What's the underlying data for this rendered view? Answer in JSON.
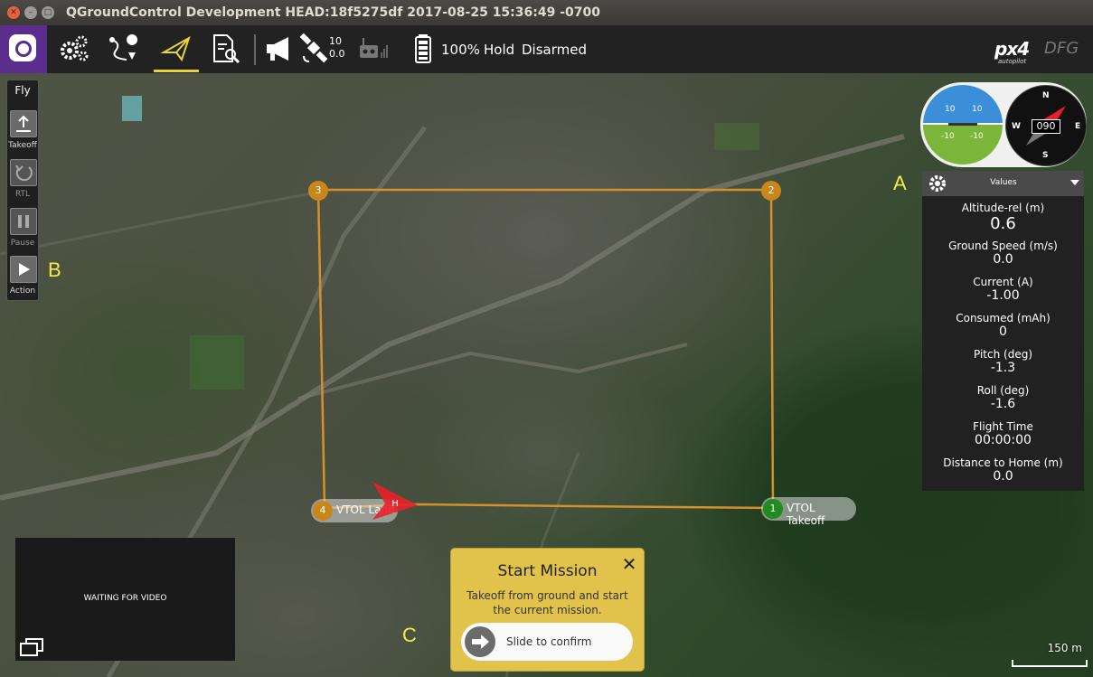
{
  "window": {
    "title": "QGroundControl Development HEAD:18f5275df 2017-08-25 15:36:49 -0700",
    "close_glyph": "✕",
    "minimize_glyph": "–",
    "maximize_glyph": "□"
  },
  "toolbar": {
    "icons": [
      "qgc-logo-icon",
      "settings-gears-icon",
      "plan-route-icon",
      "fly-paper-plane-icon",
      "analyze-log-icon",
      "messages-megaphone-icon",
      "gps-satellite-icon",
      "rc-transmitter-icon",
      "battery-icon"
    ],
    "gps_satellites": "10",
    "gps_hdop": "0.0",
    "battery": "100%",
    "flight_mode": "Hold",
    "armed_state": "Disarmed",
    "brand_logo": "px4",
    "brand_sub": "autopilot",
    "brand_right": "DFG"
  },
  "fly_toolstrip": {
    "title": "Fly",
    "buttons": [
      {
        "label": "Takeoff",
        "icon": "takeoff-icon"
      },
      {
        "label": "RTL",
        "icon": "rtl-icon"
      },
      {
        "label": "Pause",
        "icon": "pause-icon"
      },
      {
        "label": "Action",
        "icon": "play-icon"
      }
    ]
  },
  "annotations": {
    "a": "A",
    "b": "B",
    "c": "C"
  },
  "instruments": {
    "attitude_marks": [
      "10",
      "10",
      "-10",
      "-10"
    ],
    "compass": {
      "n": "N",
      "e": "E",
      "s": "S",
      "w": "W",
      "heading": "090"
    }
  },
  "values_panel": {
    "title": "Values",
    "rows": [
      {
        "label": "Altitude-rel (m)",
        "value": "0.6"
      },
      {
        "label": "Ground Speed (m/s)",
        "value": "0.0"
      },
      {
        "label": "Current (A)",
        "value": "-1.00"
      },
      {
        "label": "Consumed (mAh)",
        "value": "0"
      },
      {
        "label": "Pitch (deg)",
        "value": "-1.3"
      },
      {
        "label": "Roll (deg)",
        "value": "-1.6"
      },
      {
        "label": "Flight Time",
        "value": "00:00:00"
      },
      {
        "label": "Distance to Home (m)",
        "value": "0.0"
      }
    ]
  },
  "mission_items": [
    {
      "number": "1",
      "label": "VTOL Takeoff",
      "color": "#1e8c1e"
    },
    {
      "number": "2",
      "label": "",
      "color": "#c9861a"
    },
    {
      "number": "3",
      "label": "",
      "color": "#c9861a"
    },
    {
      "number": "4",
      "label": "VTOL Land",
      "color": "#c9861a"
    }
  ],
  "home_marker": "H",
  "video": {
    "status": "WAITING FOR VIDEO"
  },
  "start_mission": {
    "title": "Start Mission",
    "close_glyph": "✕",
    "description": "Takeoff from ground and start the current mission.",
    "slider_label": "Slide to confirm"
  },
  "map_scale": "150 m",
  "colors": {
    "accent_yellow": "#e1c24a",
    "route_orange": "#d4902a",
    "toolbar": "#222222",
    "logo_purple": "#5b2d8c"
  }
}
